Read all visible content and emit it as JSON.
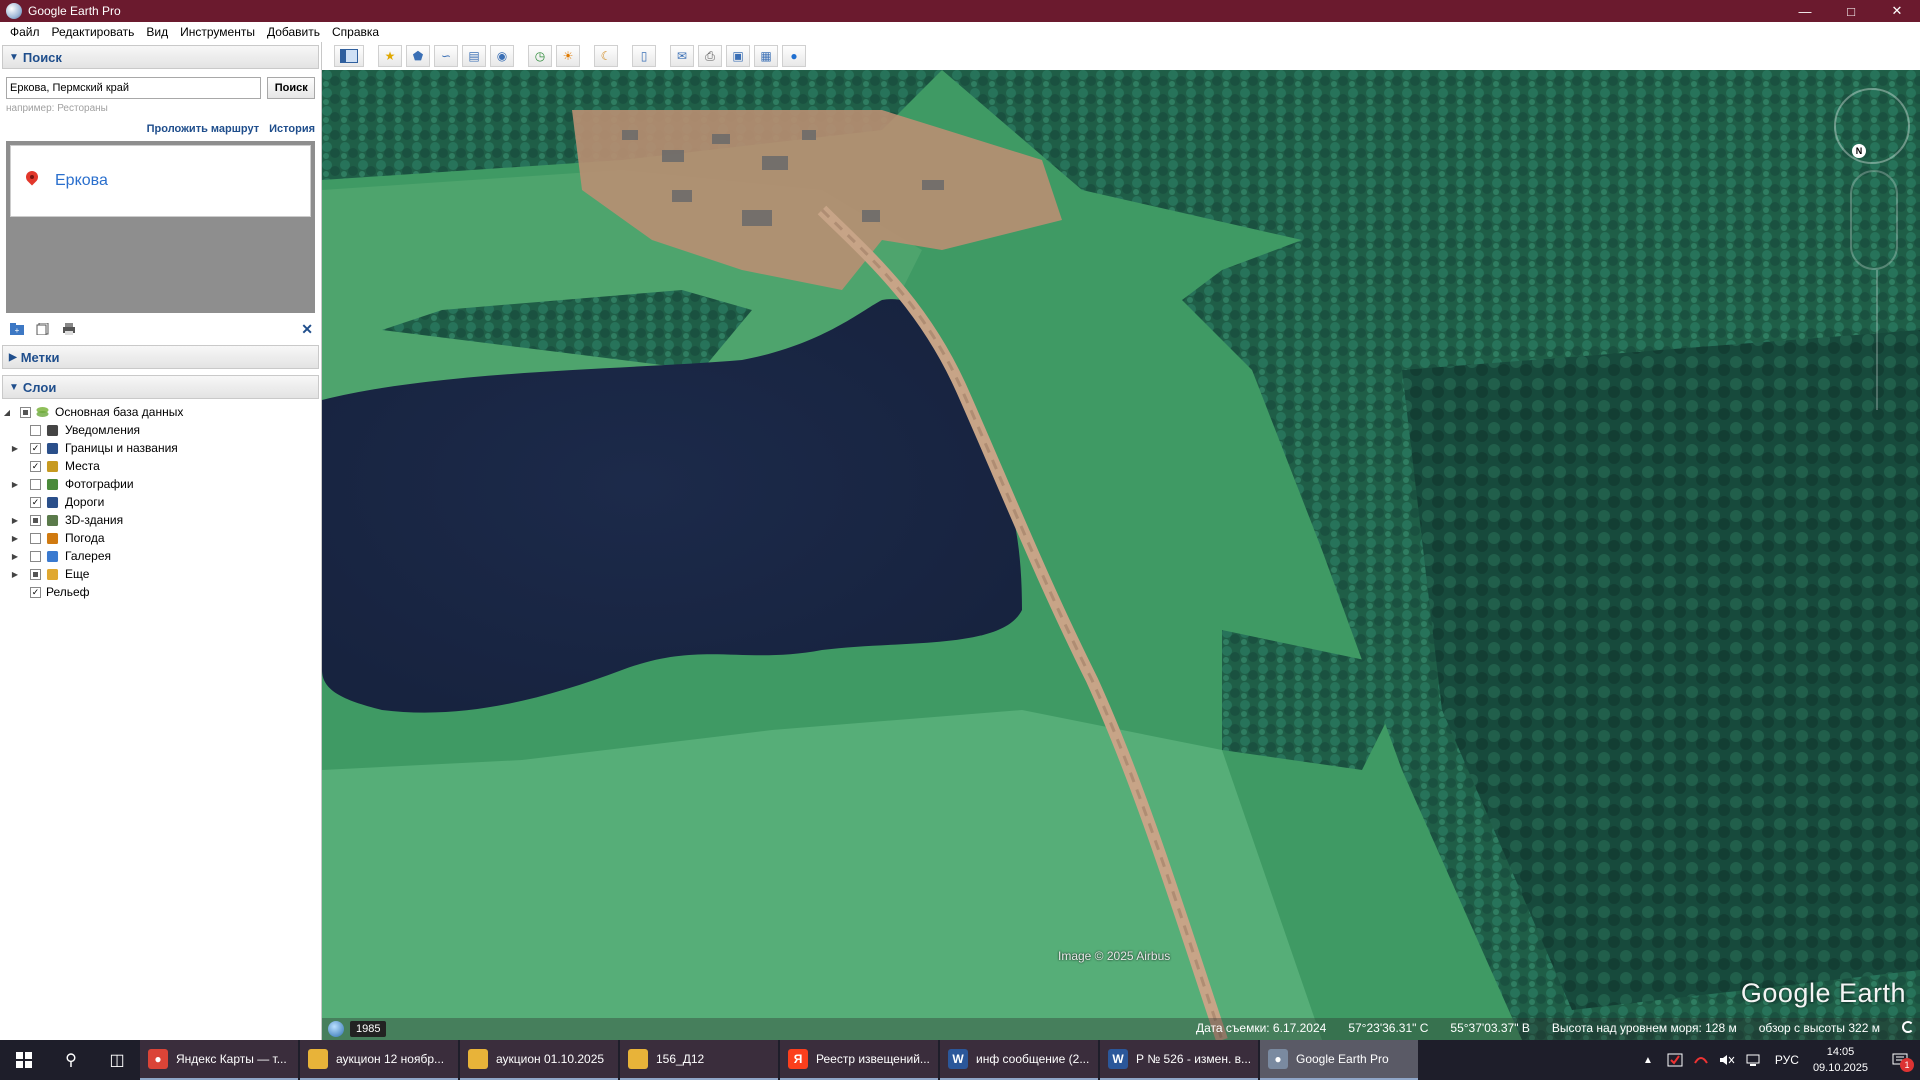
{
  "window": {
    "title": "Google Earth Pro"
  },
  "menu": [
    "Файл",
    "Редактировать",
    "Вид",
    "Инструменты",
    "Добавить",
    "Справка"
  ],
  "search": {
    "header": "Поиск",
    "value": "Еркова, Пермский край",
    "button": "Поиск",
    "hint": "например: Рестораны",
    "route_link": "Проложить маршрут",
    "history_link": "История",
    "result": "Еркова"
  },
  "places": {
    "header": "Метки"
  },
  "layers": {
    "header": "Слои",
    "root": "Основная база данных",
    "items": [
      {
        "label": "Уведомления",
        "checked": false,
        "expandable": false,
        "icon": "mail-icon"
      },
      {
        "label": "Границы и названия",
        "checked": true,
        "expandable": true,
        "icon": "flag-icon"
      },
      {
        "label": "Места",
        "checked": true,
        "expandable": false,
        "icon": "square-icon"
      },
      {
        "label": "Фотографии",
        "checked": false,
        "expandable": true,
        "icon": "photo-icon"
      },
      {
        "label": "Дороги",
        "checked": true,
        "expandable": false,
        "icon": "road-icon"
      },
      {
        "label": "3D-здания",
        "checked": "partial",
        "expandable": true,
        "icon": "building-icon"
      },
      {
        "label": "Погода",
        "checked": false,
        "expandable": true,
        "icon": "sun-icon"
      },
      {
        "label": "Галерея",
        "checked": false,
        "expandable": true,
        "icon": "star-icon"
      },
      {
        "label": "Еще",
        "checked": "partial",
        "expandable": true,
        "icon": "folder-icon"
      }
    ],
    "terrain": "Рельеф"
  },
  "map": {
    "attribution": "Image © 2025 Airbus",
    "logo": "Google Earth",
    "year": "1985",
    "status": {
      "date": "Дата съемки: 6.17.2024",
      "lat": "57°23'36.31\" С",
      "lon": "55°37'03.37\" В",
      "elevation": "Высота над уровнем моря:  128 м",
      "eye": "обзор с высоты  322 м"
    }
  },
  "taskbar": {
    "tasks": [
      {
        "label": "Яндекс Карты — т...",
        "icon": "chrome-icon",
        "color": "#db4437"
      },
      {
        "label": "аукцион 12 ноябр...",
        "icon": "folder-icon",
        "color": "#e8b339"
      },
      {
        "label": "аукцион 01.10.2025",
        "icon": "folder-icon",
        "color": "#e8b339"
      },
      {
        "label": "156_Д12",
        "icon": "folder-icon",
        "color": "#e8b339"
      },
      {
        "label": "Реестр извещений...",
        "icon": "yandex-icon",
        "color": "#fc3f1d"
      },
      {
        "label": "инф сообщение (2...",
        "icon": "word-icon",
        "color": "#2b579a"
      },
      {
        "label": "Р № 526 - измен. в...",
        "icon": "word-icon",
        "color": "#2b579a"
      },
      {
        "label": "Google Earth Pro",
        "icon": "earth-icon",
        "color": "#7a8aa0"
      }
    ],
    "lang": "РУС",
    "time": "14:05",
    "date": "09.10.2025",
    "notifications": "1"
  }
}
